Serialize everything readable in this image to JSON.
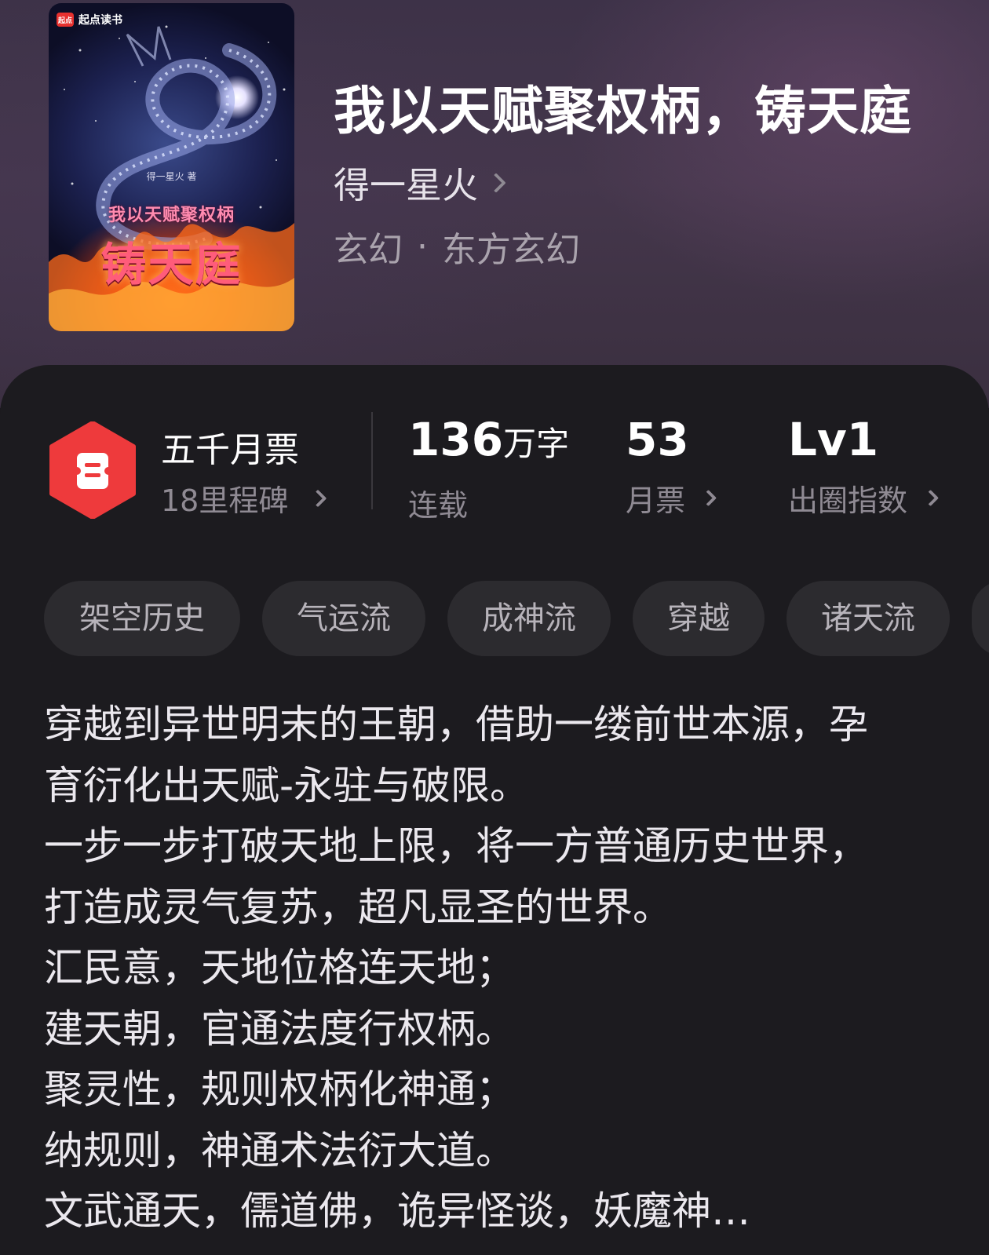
{
  "book": {
    "title": "我以天赋聚权柄，铸天庭",
    "author": "得一星火",
    "genre": "玄幻",
    "subgenre": "东方玄幻",
    "genre_separator": "·"
  },
  "cover": {
    "logo_mark": "起点",
    "logo_text": "起点读书",
    "author_text": "得一星火 著",
    "subtitle": "我以天赋聚权柄",
    "title": "铸天庭"
  },
  "stats": {
    "badge_title": "五千月票",
    "badge_subtitle": "18里程碑",
    "word_count_value": "136",
    "word_count_unit": "万字",
    "status": "连载",
    "monthly_tickets_value": "53",
    "monthly_tickets_label": "月票",
    "level_value": "Lv1",
    "level_label": "出圈指数"
  },
  "tags": [
    "架空历史",
    "气运流",
    "成神流",
    "穿越",
    "诸天流"
  ],
  "synopsis": [
    "穿越到异世明末的王朝，借助一缕前世本源，孕",
    "育衍化出天赋-永驻与破限。",
    "一步一步打破天地上限，将一方普通历史世界，",
    "打造成灵气复苏，超凡显圣的世界。",
    "汇民意，天地位格连天地；",
    "建天朝，官通法度行权柄。",
    "聚灵性，规则权柄化神通；",
    "纳规则，神通术法衍大道。",
    "文武通天，儒道佛，诡异怪谈，妖魔神…"
  ],
  "colors": {
    "badge_red": "#ee3a3c",
    "background": "#1c1b1f",
    "tag_bg": "#2c2b2f",
    "muted_text": "#8f8a93"
  }
}
